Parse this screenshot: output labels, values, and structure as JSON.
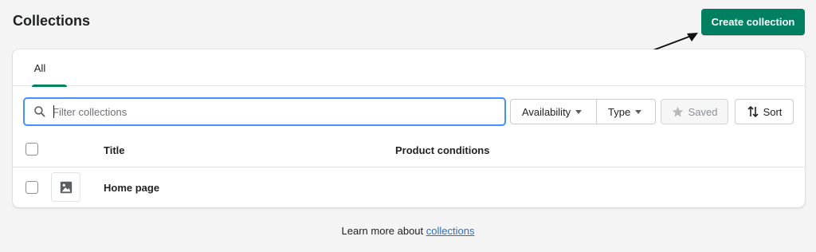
{
  "page": {
    "title": "Collections",
    "primary_action": "Create collection"
  },
  "tabs": [
    {
      "label": "All",
      "selected": true
    }
  ],
  "filters": {
    "search_placeholder": "Filter collections",
    "search_value": "",
    "availability_label": "Availability",
    "type_label": "Type",
    "saved_label": "Saved",
    "sort_label": "Sort"
  },
  "table": {
    "columns": [
      "Title",
      "Product conditions"
    ],
    "rows": [
      {
        "title": "Home page",
        "product_conditions": "",
        "image": "image-placeholder-icon"
      }
    ]
  },
  "footer": {
    "text": "Learn more about ",
    "link": "collections"
  },
  "colors": {
    "primary": "#008060",
    "focus": "#458fff",
    "link": "#2c6ecb",
    "background": "#f4f4f4"
  },
  "icons": [
    "search-icon",
    "caret-down-icon",
    "star-icon",
    "sort-arrows-icon",
    "image-placeholder-icon",
    "annotation-arrow"
  ]
}
